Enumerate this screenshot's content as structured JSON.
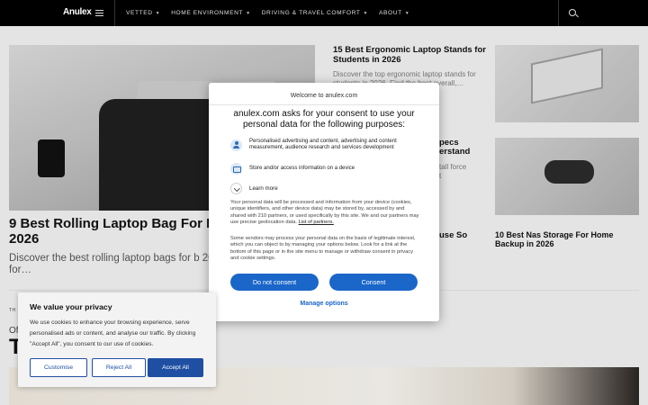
{
  "header": {
    "logo": "Anulex",
    "nav": [
      {
        "label": "VETTED"
      },
      {
        "label": "HOME ENVIRONMENT"
      },
      {
        "label": "DRIVING & TRAVEL COMFORT"
      },
      {
        "label": "ABOUT"
      }
    ]
  },
  "articles": {
    "hero_title": "9 Best Rolling Laptop Bag For Busi",
    "hero_year": "2026",
    "hero_desc": "Discover the best rolling laptop bags for b 2026. Find top picks for…",
    "mid_title": "15 Best Ergonomic Laptop Stands for Students in 2026",
    "mid_desc": "Discover the top ergonomic laptop stands for students in 2026. Find the best overall,…",
    "mid_frag_1": "pecs",
    "mid_frag_2": "erstand",
    "mid_frag_3": "tall force",
    "mid_frag_4": "t",
    "mid_frag_5": "use So",
    "right_title": "10 Best Nas Storage For Home Backup in 2026",
    "section_label": "TH",
    "of_label": "Of",
    "big_T": "T"
  },
  "consent_modal": {
    "site": "Welcome to anulex.com",
    "heading": "anulex.com asks for your consent to use your personal data for the following purposes:",
    "purposes": [
      {
        "icon": "person-icon",
        "text": "Personalised advertising and content, advertising and content measurement, audience research and services development"
      },
      {
        "icon": "device-icon",
        "text": "Store and/or access information on a device"
      }
    ],
    "learn_more": "Learn more",
    "body_1": "Your personal data will be processed and information from your device (cookies, unique identifiers, and other device data) may be stored by, accessed by and shared with 210 partners, or used specifically by this site. We and our partners may use precise geolocation data.",
    "partners_link": "List of partners.",
    "body_2": "Some vendors may process your personal data on the basis of legitimate interest, which you can object to by managing your options below. Look for a link at the bottom of this page or in the site menu to manage or withdraw consent in privacy and cookie settings.",
    "btn_reject": "Do not consent",
    "btn_accept": "Consent",
    "manage": "Manage options",
    "accent_color": "#1a66c9"
  },
  "cookie_banner": {
    "title": "We value your privacy",
    "text": "We use cookies to enhance your browsing experience, serve personalised ads or content, and analyse our traffic. By clicking \"Accept All\", you consent to our use of cookies.",
    "btn_customise": "Customise",
    "btn_reject": "Reject All",
    "btn_accept": "Accept All",
    "accent_color": "#1e4fa3"
  }
}
